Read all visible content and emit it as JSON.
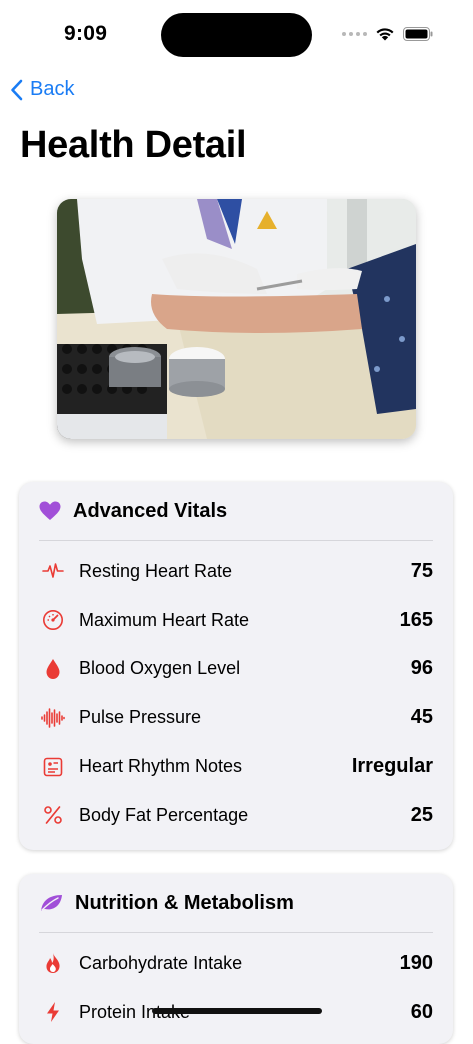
{
  "status_bar": {
    "time": "9:09"
  },
  "nav": {
    "back_label": "Back"
  },
  "page": {
    "title": "Health Detail"
  },
  "vitals": {
    "title": "Advanced Vitals",
    "rows": [
      {
        "label": "Resting Heart Rate",
        "value": "75",
        "icon": "waveform-path-icon"
      },
      {
        "label": "Maximum Heart Rate",
        "value": "165",
        "icon": "gauge-icon"
      },
      {
        "label": "Blood Oxygen Level",
        "value": "96",
        "icon": "drop-icon"
      },
      {
        "label": "Pulse Pressure",
        "value": "45",
        "icon": "waveform-icon"
      },
      {
        "label": "Heart Rhythm Notes",
        "value": "Irregular",
        "icon": "notes-card-icon"
      },
      {
        "label": "Body Fat Percentage",
        "value": "25",
        "icon": "percent-icon"
      }
    ]
  },
  "nutrition": {
    "title": "Nutrition & Metabolism",
    "rows": [
      {
        "label": "Carbohydrate Intake",
        "value": "190",
        "icon": "flame-icon"
      },
      {
        "label": "Protein Intake",
        "value": "60",
        "icon": "bolt-icon"
      }
    ]
  },
  "colors": {
    "accent_blue": "#1a7cf4",
    "vitals_purple": "#a14fd8",
    "alert_red": "#ea3b35",
    "card_bg": "#f2f2f6"
  }
}
